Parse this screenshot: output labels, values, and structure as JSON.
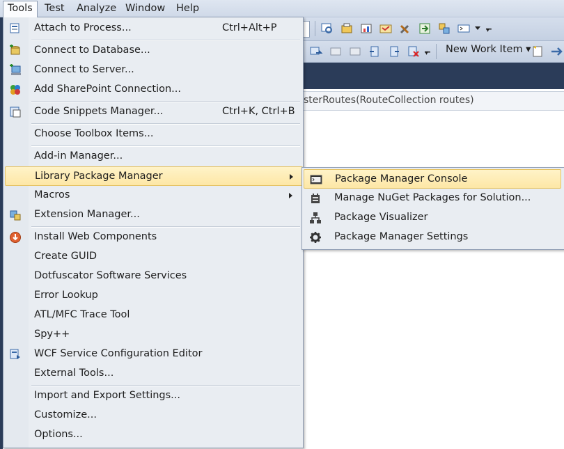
{
  "menubar": {
    "items": [
      "Tools",
      "Test",
      "Analyze",
      "Window",
      "Help"
    ],
    "active": "Tools"
  },
  "toolbar": {
    "new_work_item_label": "New Work Item ▾"
  },
  "code_nav": {
    "text": "sterRoutes(RouteCollection routes)"
  },
  "tools_menu": {
    "items": [
      {
        "label": "Attach to Process...",
        "shortcut": "Ctrl+Alt+P"
      },
      {
        "label": "Connect to Database..."
      },
      {
        "label": "Connect to Server..."
      },
      {
        "label": "Add SharePoint Connection..."
      },
      {
        "label": "Code Snippets Manager...",
        "shortcut": "Ctrl+K, Ctrl+B"
      },
      {
        "label": "Choose Toolbox Items..."
      },
      {
        "label": "Add-in Manager..."
      },
      {
        "label": "Library Package Manager"
      },
      {
        "label": "Macros"
      },
      {
        "label": "Extension Manager..."
      },
      {
        "label": "Install Web Components"
      },
      {
        "label": "Create GUID"
      },
      {
        "label": "Dotfuscator Software Services"
      },
      {
        "label": "Error Lookup"
      },
      {
        "label": "ATL/MFC Trace Tool"
      },
      {
        "label": "Spy++"
      },
      {
        "label": "WCF Service Configuration Editor"
      },
      {
        "label": "External Tools..."
      },
      {
        "label": "Import and Export Settings..."
      },
      {
        "label": "Customize..."
      },
      {
        "label": "Options..."
      }
    ]
  },
  "submenu": {
    "items": [
      {
        "label": "Package Manager Console"
      },
      {
        "label": "Manage NuGet Packages for Solution..."
      },
      {
        "label": "Package Visualizer"
      },
      {
        "label": "Package Manager Settings"
      }
    ]
  },
  "colors": {
    "highlight": "#fde7a6",
    "menu_bg": "#e9edf2",
    "dark_tab": "#2b3c59"
  }
}
